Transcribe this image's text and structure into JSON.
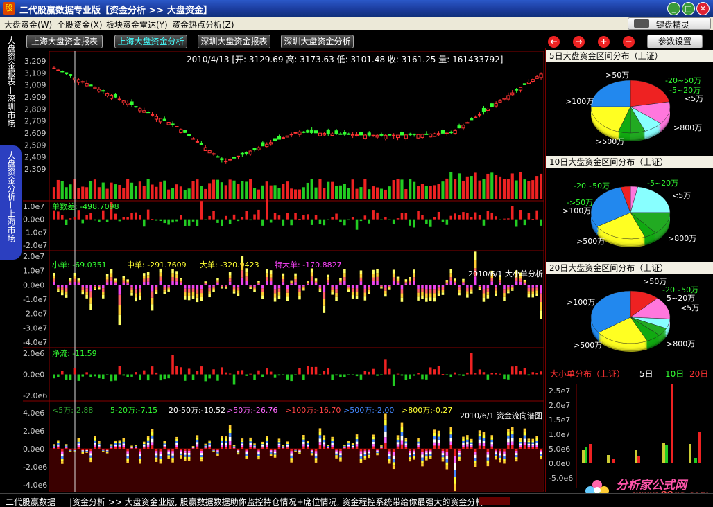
{
  "window": {
    "title": "二代股赢数据专业版【资金分析 >> 大盘资金】",
    "min": "_",
    "max": "□",
    "close": "✕"
  },
  "menu": {
    "items": [
      "大盘资金(W)",
      "个股资金(X)",
      "板块资金雷达(Y)",
      "资金热点分析(Z)"
    ],
    "keyboard_wizard": "键盘精灵"
  },
  "side_tabs": {
    "tab1": "大盘资金报表—深圳市场",
    "tab2": "大盘资金分析—上海市场"
  },
  "toolbar": {
    "buttons": [
      "上海大盘资金报表",
      "上海大盘资金分析",
      "深圳大盘资金报表",
      "深圳大盘资金分析"
    ],
    "active_index": 1,
    "nav_icons": [
      "←",
      "→",
      "+",
      "−"
    ],
    "settings": "参数设置"
  },
  "kline": {
    "info": "2010/4/13 [开: 3129.69 高: 3173.63 低: 3101.48 收: 3161.25 量: 161433792]",
    "y_ticks": [
      "3,209",
      "3,109",
      "3,009",
      "2,909",
      "2,809",
      "2,709",
      "2,609",
      "2,509",
      "2,409",
      "2,309"
    ]
  },
  "panel_diff": {
    "label": "单数差: -498.7098",
    "y_ticks": [
      "1.0e7",
      "0.0e0",
      "-1.0e7",
      "-2.0e7"
    ]
  },
  "panel_size": {
    "labels": [
      "小单: -69.0351",
      "中单: -291.7609",
      "大单: -320.9423",
      "特大单: -170.8827"
    ],
    "label_colors": [
      "#3f3",
      "#ff3",
      "#ff3",
      "#f4f"
    ],
    "caption": "2010/6/1 大小单分析",
    "y_ticks": [
      "2.0e7",
      "1.0e7",
      "0.0e0",
      "-1.0e7",
      "-2.0e7",
      "-3.0e7",
      "-4.0e7"
    ]
  },
  "panel_net": {
    "label": "净流: -11.59",
    "y_ticks": [
      "2.0e6",
      "0.0e0",
      "-2.0e6"
    ]
  },
  "panel_flow": {
    "labels": [
      "<5万:-2.88",
      "5-20万:-7.15",
      "20-50万:-10.52",
      ">50万:-26.76",
      ">100万:-16.70",
      ">500万:-2.00",
      ">800万:-0.27"
    ],
    "label_colors": [
      "#3a3",
      "#3f3",
      "#fff",
      "#f6f",
      "#f44",
      "#48f",
      "#ff3"
    ],
    "caption": "2010/6/1 资金流向谱图",
    "y_ticks": [
      "4.0e6",
      "2.0e6",
      "0.0e0",
      "-2.0e6",
      "-4.0e6"
    ]
  },
  "pies": [
    {
      "title": "5日大盘资金区间分布（上证）",
      "labels": [
        ">50万",
        "-20~50万",
        "-5~20万",
        "<5万",
        ">800万",
        ">500万",
        ">100万"
      ],
      "slices": [
        {
          "name": ">100万",
          "value": 22,
          "color": "#e22"
        },
        {
          "name": ">50万",
          "value": 14,
          "color": "#f7d"
        },
        {
          "name": "-20~50万",
          "value": 8,
          "color": "#8ff"
        },
        {
          "name": "-5~20万",
          "value": 6,
          "color": "#2a2"
        },
        {
          "name": "<5万",
          "value": 5,
          "color": "#1a1"
        },
        {
          "name": ">800万",
          "value": 20,
          "color": "#ff2"
        },
        {
          "name": ">500万",
          "value": 25,
          "color": "#28e"
        }
      ]
    },
    {
      "title": "10日大盘资金区间分布（上证）",
      "labels": [
        "-20~50万",
        "-5~20万",
        "<5万",
        "->50万",
        ">100万",
        ">500万",
        ">800万"
      ],
      "slices": [
        {
          "name": ">50万",
          "value": 3,
          "color": "#f7d"
        },
        {
          "name": "-20~50万",
          "value": 22,
          "color": "#8ff"
        },
        {
          "name": "-5~20万",
          "value": 14,
          "color": "#2a2"
        },
        {
          "name": "<5万",
          "value": 5,
          "color": "#1a1"
        },
        {
          "name": ">800万",
          "value": 22,
          "color": "#ff2"
        },
        {
          "name": ">500万",
          "value": 30,
          "color": "#28e"
        },
        {
          "name": ">100万",
          "value": 4,
          "color": "#e22"
        }
      ]
    },
    {
      "title": "20日大盘资金区间分布（上证）",
      "labels": [
        ">50万",
        "-20~50万",
        "5~20万",
        "<5万",
        ">100万",
        ">800万",
        ">500万"
      ],
      "slices": [
        {
          "name": ">100万",
          "value": 12,
          "color": "#e22"
        },
        {
          "name": ">50万",
          "value": 14,
          "color": "#f7d"
        },
        {
          "name": "-20~50万",
          "value": 6,
          "color": "#8ff"
        },
        {
          "name": "5~20万",
          "value": 5,
          "color": "#2a2"
        },
        {
          "name": "<5万",
          "value": 6,
          "color": "#1a1"
        },
        {
          "name": ">800万",
          "value": 22,
          "color": "#ff2"
        },
        {
          "name": ">500万",
          "value": 35,
          "color": "#28e"
        }
      ]
    }
  ],
  "distribution": {
    "title": "大小单分布（上证）",
    "periods": [
      "5日",
      "10日",
      "20日"
    ],
    "y_ticks": [
      "2.5e7",
      "2.0e7",
      "1.5e7",
      "1.0e7",
      "5.0e6",
      "0.0e0",
      "-5.0e6"
    ]
  },
  "status": {
    "app": "二代股赢数据",
    "crumb": "|资金分析 >> 大盘资金",
    "ticker": "业版, 股赢数据数据助你监控持仓情况+席位情况, 资金程控系统带给你最强大的资金分析"
  },
  "logo": {
    "text": "分析家公式网",
    "url": "www.88gs.com"
  }
}
